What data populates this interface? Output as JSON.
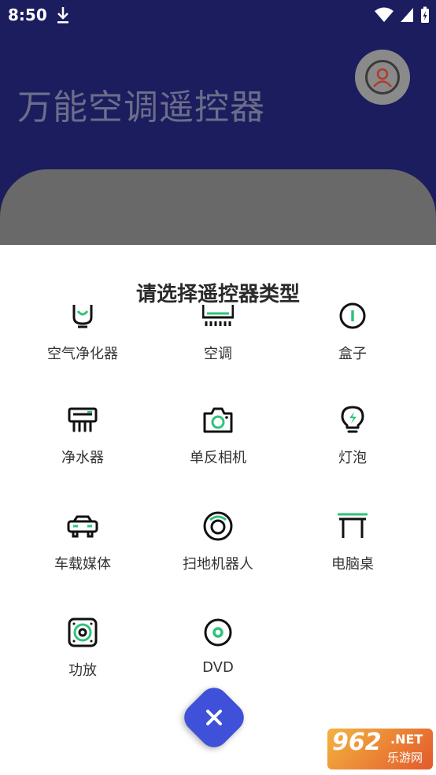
{
  "status_bar": {
    "time": "8:50"
  },
  "app": {
    "title": "万能空调遥控器"
  },
  "sheet": {
    "title": "请选择遥控器类型",
    "items": [
      {
        "label": "空气净化器",
        "icon": "air-purifier-icon"
      },
      {
        "label": "空调",
        "icon": "air-conditioner-icon"
      },
      {
        "label": "盒子",
        "icon": "tv-box-icon"
      },
      {
        "label": "净水器",
        "icon": "water-purifier-icon"
      },
      {
        "label": "单反相机",
        "icon": "camera-icon"
      },
      {
        "label": "灯泡",
        "icon": "light-bulb-icon"
      },
      {
        "label": "车载媒体",
        "icon": "car-media-icon"
      },
      {
        "label": "扫地机器人",
        "icon": "robot-vacuum-icon"
      },
      {
        "label": "电脑桌",
        "icon": "computer-desk-icon"
      },
      {
        "label": "功放",
        "icon": "amplifier-icon"
      },
      {
        "label": "DVD",
        "icon": "dvd-icon"
      }
    ]
  },
  "watermark": {
    "number": "962",
    "net": ".NET",
    "cn": "乐游网"
  },
  "colors": {
    "accent": "#2ec47a",
    "fab": "#3f51d8",
    "header": "#1b1d5e"
  }
}
